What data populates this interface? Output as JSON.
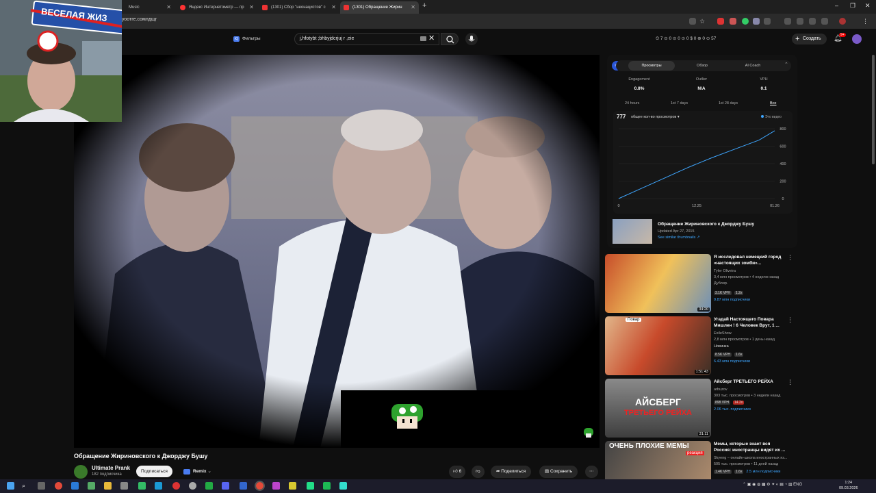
{
  "browser": {
    "tabs": [
      {
        "label": "Music",
        "active": false
      },
      {
        "label": "Яндекс Интернетометр — пр",
        "active": false
      },
      {
        "label": "(1301) Сбор \"неонацистов\" с",
        "active": false
      },
      {
        "label": "(1301) Обращение Жирин",
        "active": true
      }
    ],
    "url": "уоотге.сомлдщг"
  },
  "webcam": {
    "sign_text": "ВЕСЕЛАЯ ЖИЗ"
  },
  "youtube": {
    "filters_label": "Фильтры",
    "search_value": "j,hfotybt ;bhbyjdcrjuj r ,eie",
    "stats_text": "⏲ 7  ⊙ 0  ⊙ 0  ⊙ 0  $ 0  ⊕ 0  ⊙ 57",
    "create_label": "Создать",
    "bell_badge": "9+"
  },
  "video": {
    "title": "Обращение Жириновского к Джорджу Бушу",
    "channel": "Ultimate Prank",
    "subscribers": "182 подписчика",
    "subscribe_label": "Подписаться",
    "remix_label": "Remix",
    "likes": "6",
    "share_label": "Поделиться",
    "save_label": "Сохранить",
    "more_label": "⋯"
  },
  "panel": {
    "tabs": [
      "Просмотры",
      "Обзор",
      "AI Coach"
    ],
    "metrics": [
      {
        "label": "Engagement",
        "value": "0.8%"
      },
      {
        "label": "Outlier",
        "value": "N/A"
      },
      {
        "label": "VPH",
        "value": "0.1"
      }
    ],
    "ranges": [
      "24 hours",
      "1st 7 days",
      "1st 28 days",
      "Все"
    ],
    "views_total": "777",
    "views_label": "общее кол-во просмотров ▾",
    "legend": "Это видео",
    "preview_title": "Обращение Жириновского к Джорджу Бушу",
    "preview_updated": "Updated Apr 27, 2015",
    "preview_link": "See similar thumbnails ↗"
  },
  "chart_data": {
    "type": "line",
    "x_ticks": [
      "0",
      "12.25",
      "01.26"
    ],
    "y_ticks": [
      "0",
      "200",
      "400",
      "600",
      "800"
    ],
    "ylim": [
      0,
      800
    ],
    "series": [
      {
        "name": "Это видео",
        "x": [
          0,
          0.15,
          0.3,
          0.45,
          0.6,
          0.75,
          0.9,
          1
        ],
        "values": [
          0,
          120,
          240,
          360,
          470,
          570,
          670,
          777
        ]
      }
    ],
    "grid": true,
    "legend": "top-right"
  },
  "recommendations": [
    {
      "title": "Я исследовал немецкий город «настоящих зомби»...",
      "channel": "Tyler Oliveira",
      "meta": "3,4 млн просмотров • 4 недели назад",
      "badge": "Дублир.",
      "tags": [
        "3.1K VPH",
        "1.2x"
      ],
      "subs": "9.87 млн подписчики",
      "duration": "34:20"
    },
    {
      "title": "Угадай Настоящего Повара Мишлен ! 6 Человек Врут, 1 ...",
      "channel": "ExileShow",
      "meta": "2,8 млн просмотров • 1 день назад",
      "badge": "Новинка",
      "tags": [
        "8.5K VPH",
        "1.6x"
      ],
      "subs": "6.43 млн подписчики",
      "duration": "1:51:43"
    },
    {
      "title": "Айсберг ТРЕТЬЕГО РЕЙХА",
      "channel": "arbuzov",
      "meta": "303 тыс. просмотров • 3 недели назад",
      "badge": "",
      "tags": [
        "898 VPH",
        "14.2x"
      ],
      "subs": "2.06 тыс. подписчики",
      "duration": "31:11"
    },
    {
      "title": "Мемы, которые знает вся Россия: иностранцы видят их ...",
      "channel": "Skyeng – онлайн-школа иностранных яз...",
      "meta": "505 тыс. просмотров • 11 дней назад",
      "badge": "",
      "tags": [
        "1.4K VPH",
        "1.6x"
      ],
      "subs": "2.5 млн подписчики",
      "duration": ""
    }
  ],
  "thumb_text": {
    "berg_top": "АЙСБЕРГ",
    "berg_bottom": "ТРЕТЬЕГО РЕЙХА",
    "memes": "ОЧЕНЬ ПЛОХИЕ МЕМЫ",
    "reaction": "реакция",
    "chef": "Повар"
  },
  "taskbar": {
    "tray": "ENG",
    "time": "1:24",
    "date": "09.03.2026"
  }
}
